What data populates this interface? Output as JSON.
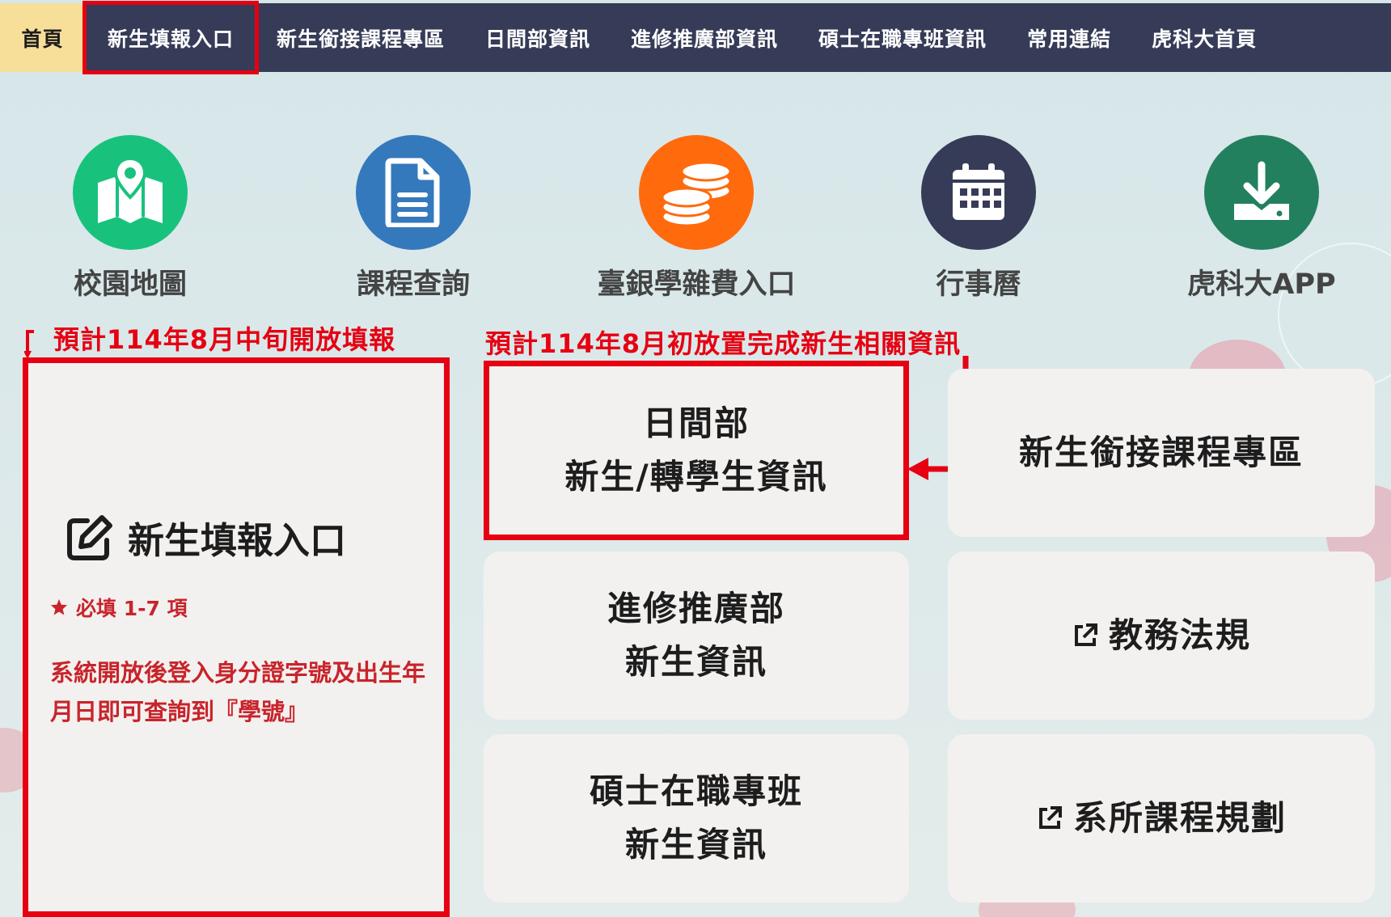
{
  "nav": {
    "items": [
      {
        "label": "首頁"
      },
      {
        "label": "新生填報入口"
      },
      {
        "label": "新生銜接課程專區"
      },
      {
        "label": "日間部資訊"
      },
      {
        "label": "進修推廣部資訊"
      },
      {
        "label": "碩士在職專班資訊"
      },
      {
        "label": "常用連結"
      },
      {
        "label": "虎科大首頁"
      }
    ]
  },
  "shortcuts": [
    {
      "label": "校園地圖",
      "icon": "map-pin-icon",
      "color": "#18c27d"
    },
    {
      "label": "課程查詢",
      "icon": "document-icon",
      "color": "#3579bd"
    },
    {
      "label": "臺銀學雜費入口",
      "icon": "coins-icon",
      "color": "#ff6a0d"
    },
    {
      "label": "行事曆",
      "icon": "calendar-icon",
      "color": "#363b57"
    },
    {
      "label": "虎科大APP",
      "icon": "download-icon",
      "color": "#23805f"
    }
  ],
  "annotations": {
    "left": "預計114年8月中旬開放填報",
    "right": "預計114年8月初放置完成新生相關資訊"
  },
  "entry": {
    "title": "新生填報入口",
    "required": "必填 1-7 項",
    "notice": "系統開放後登入身分證字號及出生年月日即可查詢到『學號』"
  },
  "cards": {
    "day": {
      "line1": "日間部",
      "line2": "新生/轉學生資訊"
    },
    "bridge": {
      "line1": "新生銜接課程專區"
    },
    "extension": {
      "line1": "進修推廣部",
      "line2": "新生資訊"
    },
    "rules": {
      "line1": "教務法規"
    },
    "master": {
      "line1": "碩士在職專班",
      "line2": "新生資訊"
    },
    "curriculum": {
      "line1": "系所課程規劃"
    }
  },
  "colors": {
    "accent_red": "#e60012",
    "nav_bg": "#363b57",
    "nav_active": "#f7df9a"
  }
}
